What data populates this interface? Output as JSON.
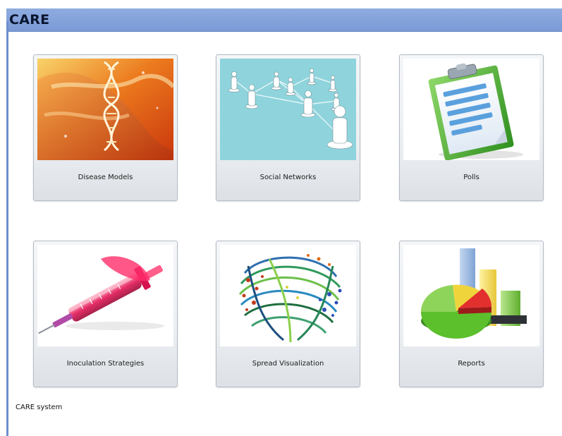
{
  "window": {
    "title": "CARE",
    "footer_status": "CARE system"
  },
  "tiles": [
    {
      "label": "Disease Models",
      "icon": "dna-hand-icon"
    },
    {
      "label": "Social Networks",
      "icon": "social-network-icon"
    },
    {
      "label": "Polls",
      "icon": "clipboard-icon"
    },
    {
      "label": "Inoculation Strategies",
      "icon": "syringe-icon"
    },
    {
      "label": "Spread Visualization",
      "icon": "spread-visualization-icon"
    },
    {
      "label": "Reports",
      "icon": "charts-icon"
    }
  ],
  "colors": {
    "title_bar": "#7b9ad6",
    "title_text": "#0a1630",
    "tile_border": "#b5bcc6"
  }
}
